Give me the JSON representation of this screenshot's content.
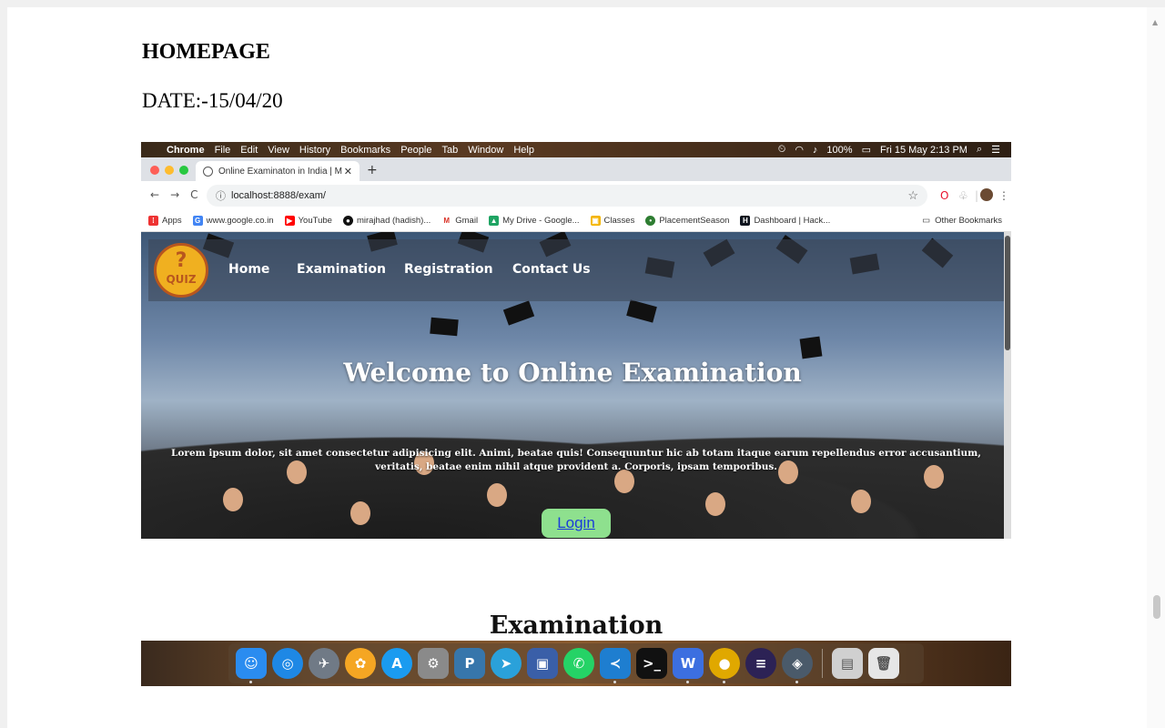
{
  "page": {
    "title": "HOMEPAGE",
    "date": "DATE:-15/04/20"
  },
  "menubar": {
    "app": "Chrome",
    "items": [
      "File",
      "Edit",
      "View",
      "History",
      "Bookmarks",
      "People",
      "Tab",
      "Window",
      "Help"
    ],
    "battery": "100%",
    "datetime": "Fri 15 May  2:13 PM"
  },
  "browser": {
    "tab_title": "Online Examinaton in India | M",
    "url": "localhost:8888/exam/",
    "bookmarks": [
      {
        "label": "Apps",
        "icon": "apps-grid-icon",
        "color": "#e33"
      },
      {
        "label": "www.google.co.in",
        "icon": "google-icon",
        "color": "#4285f4"
      },
      {
        "label": "YouTube",
        "icon": "youtube-icon",
        "color": "#ff0000"
      },
      {
        "label": "mirajhad (hadish)...",
        "icon": "github-icon",
        "color": "#111111"
      },
      {
        "label": "Gmail",
        "icon": "gmail-icon",
        "color": "#d93025"
      },
      {
        "label": "My Drive - Google...",
        "icon": "drive-icon",
        "color": "#1fa463"
      },
      {
        "label": "Classes",
        "icon": "classroom-icon",
        "color": "#f4b400"
      },
      {
        "label": "PlacementSeason",
        "icon": "placement-icon",
        "color": "#2e7d32"
      },
      {
        "label": "Dashboard | Hack...",
        "icon": "hackerrank-icon",
        "color": "#0e141e"
      }
    ],
    "other_bookmarks": "Other Bookmarks"
  },
  "site": {
    "logo_text": "QUIZ",
    "nav": [
      "Home",
      "Examination",
      "Registration",
      "Contact Us"
    ],
    "hero_title": "Welcome to Online Examination",
    "hero_text": "Lorem ipsum dolor, sit amet consectetur adipisicing elit. Animi, beatae quis! Consequuntur hic ab totam itaque earum repellendus error accusantium, veritatis, beatae enim nihil atque provident a. Corporis, ipsam temporibus.",
    "login": "Login",
    "section_title": "Examination"
  },
  "dock": {
    "apps": [
      {
        "name": "finder-icon",
        "color": "#2a8cf0",
        "glyph": "☺"
      },
      {
        "name": "safari-icon",
        "color": "#1e88e5",
        "glyph": "◎"
      },
      {
        "name": "launchpad-icon",
        "color": "#707a86",
        "glyph": "✈"
      },
      {
        "name": "photos-icon",
        "color": "#f5a623",
        "glyph": "✿"
      },
      {
        "name": "app-store-icon",
        "color": "#1a9bf0",
        "glyph": "A"
      },
      {
        "name": "system-preferences-icon",
        "color": "#8a8a8a",
        "glyph": "⚙"
      },
      {
        "name": "python-icon",
        "color": "#3776ab",
        "glyph": "P"
      },
      {
        "name": "telegram-icon",
        "color": "#2aa1da",
        "glyph": "➤"
      },
      {
        "name": "virtualbox-icon",
        "color": "#3a5fa8",
        "glyph": "▣"
      },
      {
        "name": "whatsapp-icon",
        "color": "#25d366",
        "glyph": "✆"
      },
      {
        "name": "vscode-icon",
        "color": "#1e7ed0",
        "glyph": "≺"
      },
      {
        "name": "terminal-icon",
        "color": "#111111",
        "glyph": ">_"
      },
      {
        "name": "wps-office-icon",
        "color": "#3c6fe0",
        "glyph": "W"
      },
      {
        "name": "chrome-icon",
        "color": "#e0a800",
        "glyph": "●"
      },
      {
        "name": "eclipse-icon",
        "color": "#2c2255",
        "glyph": "≡"
      },
      {
        "name": "sequel-pro-icon",
        "color": "#4a5a6a",
        "glyph": "◈"
      }
    ],
    "extras": [
      {
        "name": "downloads-stack-icon",
        "color": "#d0d0d0",
        "glyph": "▤"
      },
      {
        "name": "trash-icon",
        "color": "#e6e6e6",
        "glyph": "🗑"
      }
    ]
  }
}
